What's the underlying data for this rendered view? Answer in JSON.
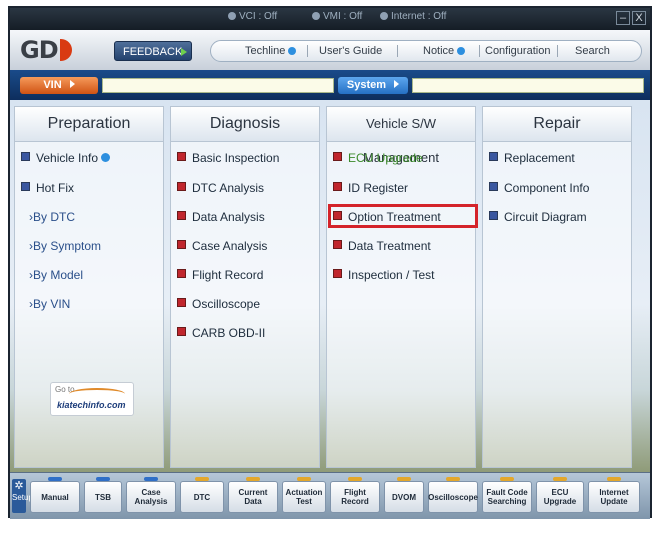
{
  "titlebar": {
    "vci": "VCI : Off",
    "vmi": "VMI : Off",
    "internet": "Internet : Off",
    "min": "–",
    "close": "X"
  },
  "logo": "GD",
  "feedback": "FEEDBACK",
  "menu": {
    "techline": "Techline",
    "users_guide": "User's Guide",
    "notice": "Notice",
    "configuration": "Configuration",
    "search": "Search"
  },
  "vin": {
    "label": "VIN",
    "value": ""
  },
  "system": {
    "label": "System",
    "value": ""
  },
  "columns": {
    "preparation": {
      "title": "Preparation",
      "items": [
        "Vehicle Info",
        "Hot Fix",
        "By DTC",
        "By Symptom",
        "By Model",
        "By VIN"
      ]
    },
    "diagnosis": {
      "title": "Diagnosis",
      "items": [
        "Basic Inspection",
        "DTC Analysis",
        "Data Analysis",
        "Case Analysis",
        "Flight Record",
        "Oscilloscope",
        "CARB OBD-II"
      ]
    },
    "vsw": {
      "title": "Vehicle S/W Management",
      "items": [
        "ECU Upgrade",
        "ID Register",
        "Option Treatment",
        "Data Treatment",
        "Inspection / Test"
      ]
    },
    "repair": {
      "title": "Repair",
      "items": [
        "Replacement",
        "Component Info",
        "Circuit Diagram"
      ]
    }
  },
  "golink": {
    "line1": "Go to",
    "line2": "kiatechinfo.com"
  },
  "bottom": {
    "setup": "Setup",
    "buttons": [
      "Manual",
      "TSB",
      "Case Analysis",
      "DTC",
      "Current Data",
      "Actuation Test",
      "Flight Record",
      "DVOM",
      "Oscilloscope",
      "Fault Code Searching",
      "ECU Upgrade",
      "Internet Update"
    ]
  }
}
